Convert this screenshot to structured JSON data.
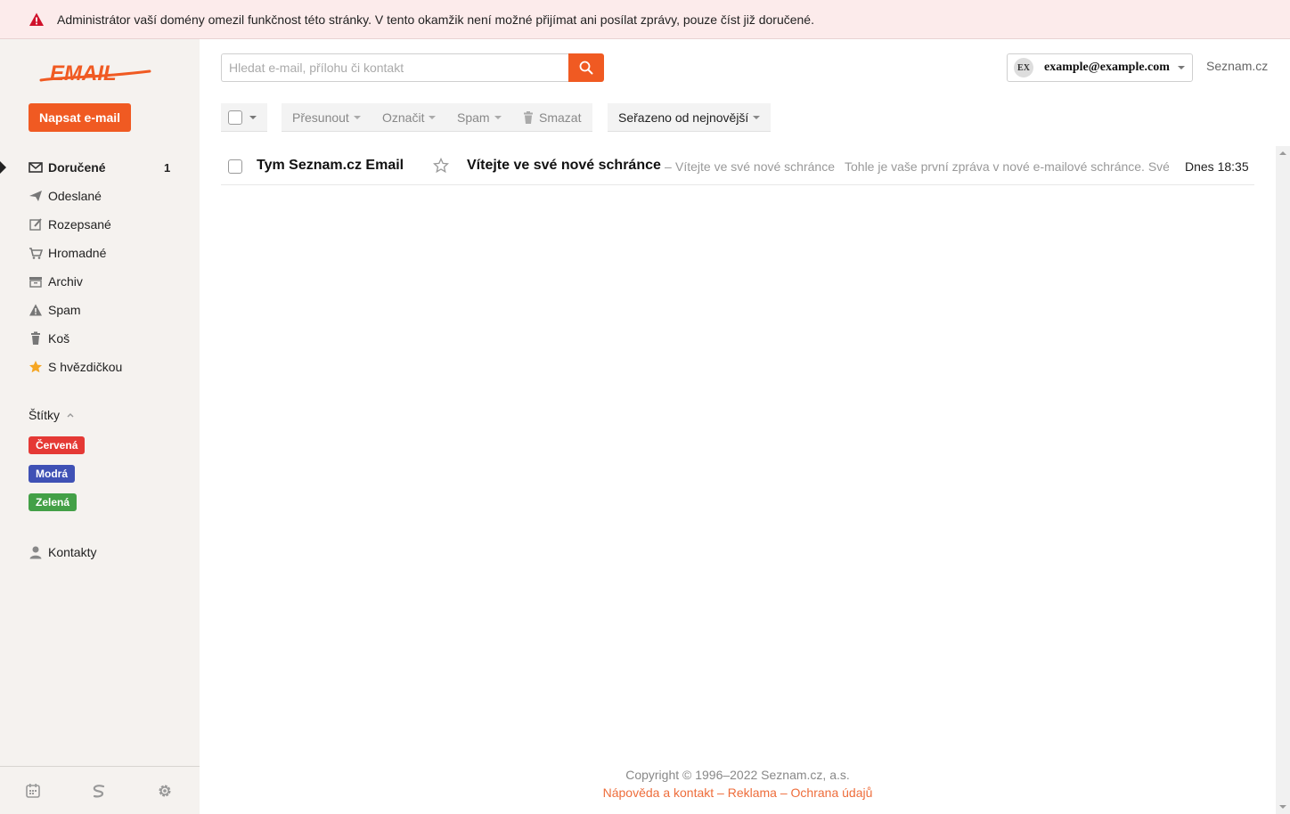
{
  "banner": {
    "icon": "warning-icon",
    "text": "Administrátor vaší domény omezil funkčnost této stránky. V tento okamžik není možné přijímat ani posílat zprávy, pouze číst již doručené."
  },
  "sidebar": {
    "logo_text": "EMAIL",
    "compose_label": "Napsat e-mail",
    "folders": [
      {
        "label": "Doručené",
        "icon": "inbox-icon",
        "count": "1",
        "active": true
      },
      {
        "label": "Odeslané",
        "icon": "sent-icon"
      },
      {
        "label": "Rozepsané",
        "icon": "drafts-icon"
      },
      {
        "label": "Hromadné",
        "icon": "bulk-icon"
      },
      {
        "label": "Archiv",
        "icon": "archive-icon"
      },
      {
        "label": "Spam",
        "icon": "spam-icon"
      },
      {
        "label": "Koš",
        "icon": "trash-icon"
      },
      {
        "label": "S hvězdičkou",
        "icon": "star-icon"
      }
    ],
    "labels_heading": "Štítky",
    "labels": [
      {
        "label": "Červená",
        "color": "#e53935"
      },
      {
        "label": "Modrá",
        "color": "#3f51b5"
      },
      {
        "label": "Zelená",
        "color": "#43a047"
      }
    ],
    "contacts_label": "Kontakty"
  },
  "header": {
    "search_placeholder": "Hledat e-mail, přílohu či kontakt",
    "account_initials": "EX",
    "account_email": "example@example.com",
    "seznam_link": "Seznam.cz"
  },
  "toolbar": {
    "move_label": "Přesunout",
    "mark_label": "Označit",
    "spam_label": "Spam",
    "delete_label": "Smazat",
    "sort_label": "Seřazeno od nejnovější"
  },
  "messages": [
    {
      "sender": "Tym Seznam.cz Email",
      "subject": "Vítejte ve své nové schránce",
      "dash": "–",
      "preview_subject": "Vítejte ve své nové schránce",
      "preview_body": "Tohle je vaše první zpráva v nové e-mailové schránce. Své",
      "date": "Dnes 18:35"
    }
  ],
  "footer": {
    "copyright": "Copyright © 1996–2022 Seznam.cz, a.s.",
    "help_link": "Nápověda a kontakt",
    "ads_link": "Reklama",
    "privacy_link": "Ochrana údajů",
    "separator": "–"
  },
  "colors": {
    "accent": "#f05a22",
    "sidebar_bg": "#f5f2ef",
    "banner_bg": "#fcebeb",
    "link": "#ee6d3b"
  }
}
